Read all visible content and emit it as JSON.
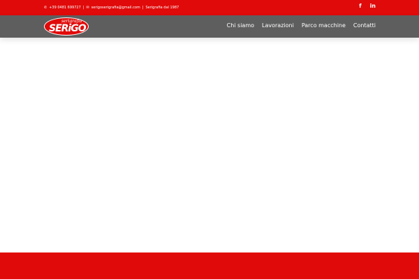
{
  "topbar": {
    "phone": "+39 0481 699727",
    "email": "serigoserigrafia@gmail.com",
    "tagline": "Serigrafia dal 1987",
    "separator": "|",
    "social": [
      {
        "icon": "facebook-icon",
        "label": "f"
      },
      {
        "icon": "linkedin-icon",
        "label": "in"
      }
    ]
  },
  "logo": {
    "small": "serigrafia",
    "big": "SERiGO"
  },
  "menu": [
    "Chi siamo",
    "Lavorazioni",
    "Parco macchine",
    "Contatti"
  ],
  "colors": {
    "brand": "#e10a0a",
    "nav": "#5e5e5e"
  }
}
